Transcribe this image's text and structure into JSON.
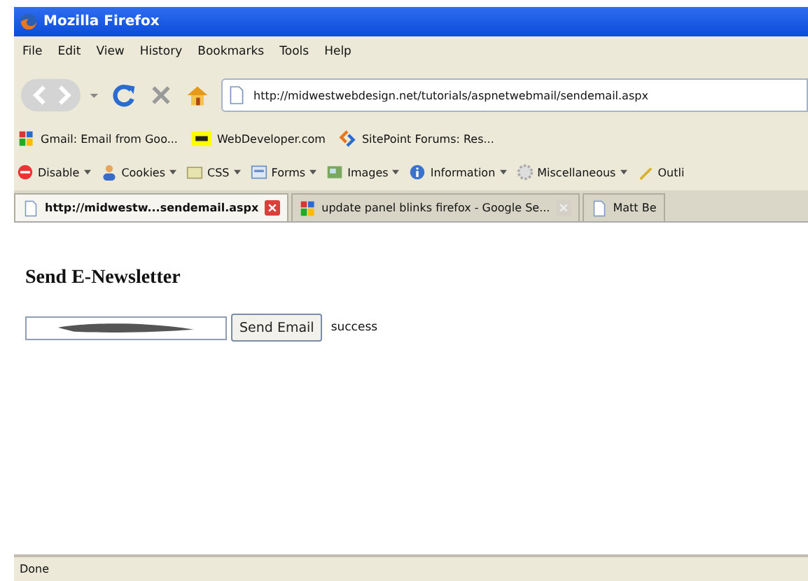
{
  "window": {
    "title": "Mozilla Firefox"
  },
  "menu": [
    "File",
    "Edit",
    "View",
    "History",
    "Bookmarks",
    "Tools",
    "Help"
  ],
  "address": {
    "value": "http://midwestwebdesign.net/tutorials/aspnetwebmail/sendemail.aspx"
  },
  "bookmarks": [
    "Gmail: Email from Goo...",
    "WebDeveloper.com",
    "SitePoint Forums: Res..."
  ],
  "webdev_toolbar": [
    "Disable",
    "Cookies",
    "CSS",
    "Forms",
    "Images",
    "Information",
    "Miscellaneous",
    "Outli"
  ],
  "tabs": [
    {
      "label": "http://midwestw...sendemail.aspx",
      "selected": true
    },
    {
      "label": "update panel blinks firefox - Google Se...",
      "selected": false
    },
    {
      "label": "Matt Be",
      "selected": false
    }
  ],
  "page": {
    "heading": "Send E-Newsletter",
    "button": "Send Email",
    "result": "success"
  },
  "status_bar": "Done"
}
